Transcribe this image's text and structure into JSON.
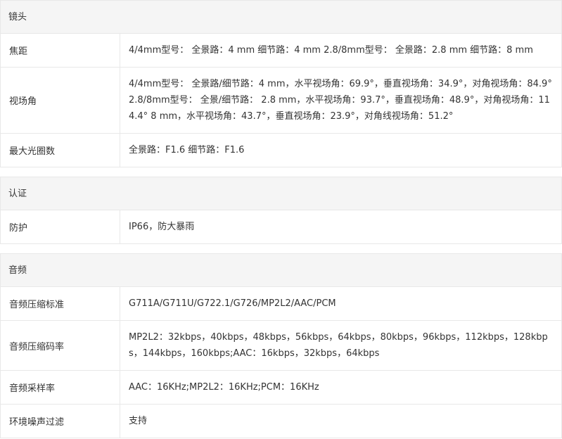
{
  "sections": [
    {
      "title": "镜头",
      "rows": [
        {
          "label": "焦距",
          "value": "4/4mm型号： 全景路：4 mm 细节路：4 mm 2.8/8mm型号： 全景路：2.8 mm 细节路：8 mm"
        },
        {
          "label": "视场角",
          "value": "4/4mm型号： 全景路/细节路：4 mm，水平视场角：69.9°，垂直视场角：34.9°，对角视场角：84.9° 2.8/8mm型号： 全景/细节路： 2.8 mm，水平视场角：93.7°，垂直视场角：48.9°，对角视场角：114.4° 8 mm，水平视场角：43.7°，垂直视场角：23.9°，对角线视场角：51.2°"
        },
        {
          "label": "最大光圈数",
          "value": "全景路：F1.6 细节路：F1.6"
        }
      ]
    },
    {
      "title": "认证",
      "rows": [
        {
          "label": "防护",
          "value": "IP66，防大暴雨"
        }
      ]
    },
    {
      "title": "音频",
      "rows": [
        {
          "label": "音频压缩标准",
          "value": "G711A/G711U/G722.1/G726/MP2L2/AAC/PCM"
        },
        {
          "label": "音频压缩码率",
          "value": "MP2L2：32kbps，40kbps，48kbps，56kbps，64kbps，80kbps，96kbps，112kbps，128kbps，144kbps，160kbps;AAC：16kbps，32kbps，64kbps"
        },
        {
          "label": "音频采样率",
          "value": "AAC：16KHz;MP2L2：16KHz;PCM：16KHz"
        },
        {
          "label": "环境噪声过滤",
          "value": "支持"
        }
      ]
    }
  ]
}
